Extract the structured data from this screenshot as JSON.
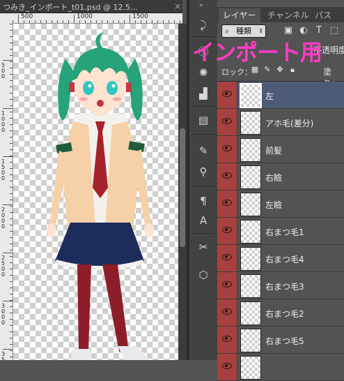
{
  "document": {
    "tab_title": "つみき_インポート_t01.psd @ 12.5...",
    "close_glyph": "×",
    "ruler_top_labels": [
      "500",
      "1000",
      "1500"
    ],
    "ruler_left_labels": [
      "500",
      "1000",
      "1500",
      "2000",
      "2500",
      "3000",
      "3500"
    ]
  },
  "overlay": {
    "title": "インポート用",
    "color": "#ff3cc4"
  },
  "toolstrip": {
    "collapse_glyph": "»",
    "tools": [
      "history-icon",
      "info-icon",
      "color-icon",
      "histogram-icon",
      "adjustments-icon",
      "brush-icon",
      "clone-source-icon",
      "paragraph-icon",
      "character-icon",
      "tool-presets-icon",
      "3d-icon"
    ]
  },
  "panel": {
    "tabs": [
      "レイヤー",
      "チャンネル",
      "パス"
    ],
    "active_tab": 0,
    "kind_select": "種類",
    "kind_select_icon": "⌕",
    "kind_select_arrow": "⇕",
    "filter_icons": [
      "image-filter-icon",
      "adjustment-filter-icon",
      "type-filter-icon",
      "shape-filter-icon"
    ],
    "opacity_label": "不透明度：",
    "lock_label": "ロック：",
    "fill_label": "塗り：",
    "layers": [
      {
        "name": "左",
        "selected": true
      },
      {
        "name": "アホ毛(差分)",
        "selected": false
      },
      {
        "name": "前髪",
        "selected": false
      },
      {
        "name": "右瞼",
        "selected": false
      },
      {
        "name": "左瞼",
        "selected": false
      },
      {
        "name": "右まつ毛1",
        "selected": false
      },
      {
        "name": "右まつ毛4",
        "selected": false
      },
      {
        "name": "右まつ毛3",
        "selected": false
      },
      {
        "name": "右まつ毛2",
        "selected": false
      },
      {
        "name": "右まつ毛5",
        "selected": false
      },
      {
        "name": "",
        "selected": false
      }
    ],
    "eye_color": "#a6413f",
    "selected_color": "#4d5a75"
  }
}
